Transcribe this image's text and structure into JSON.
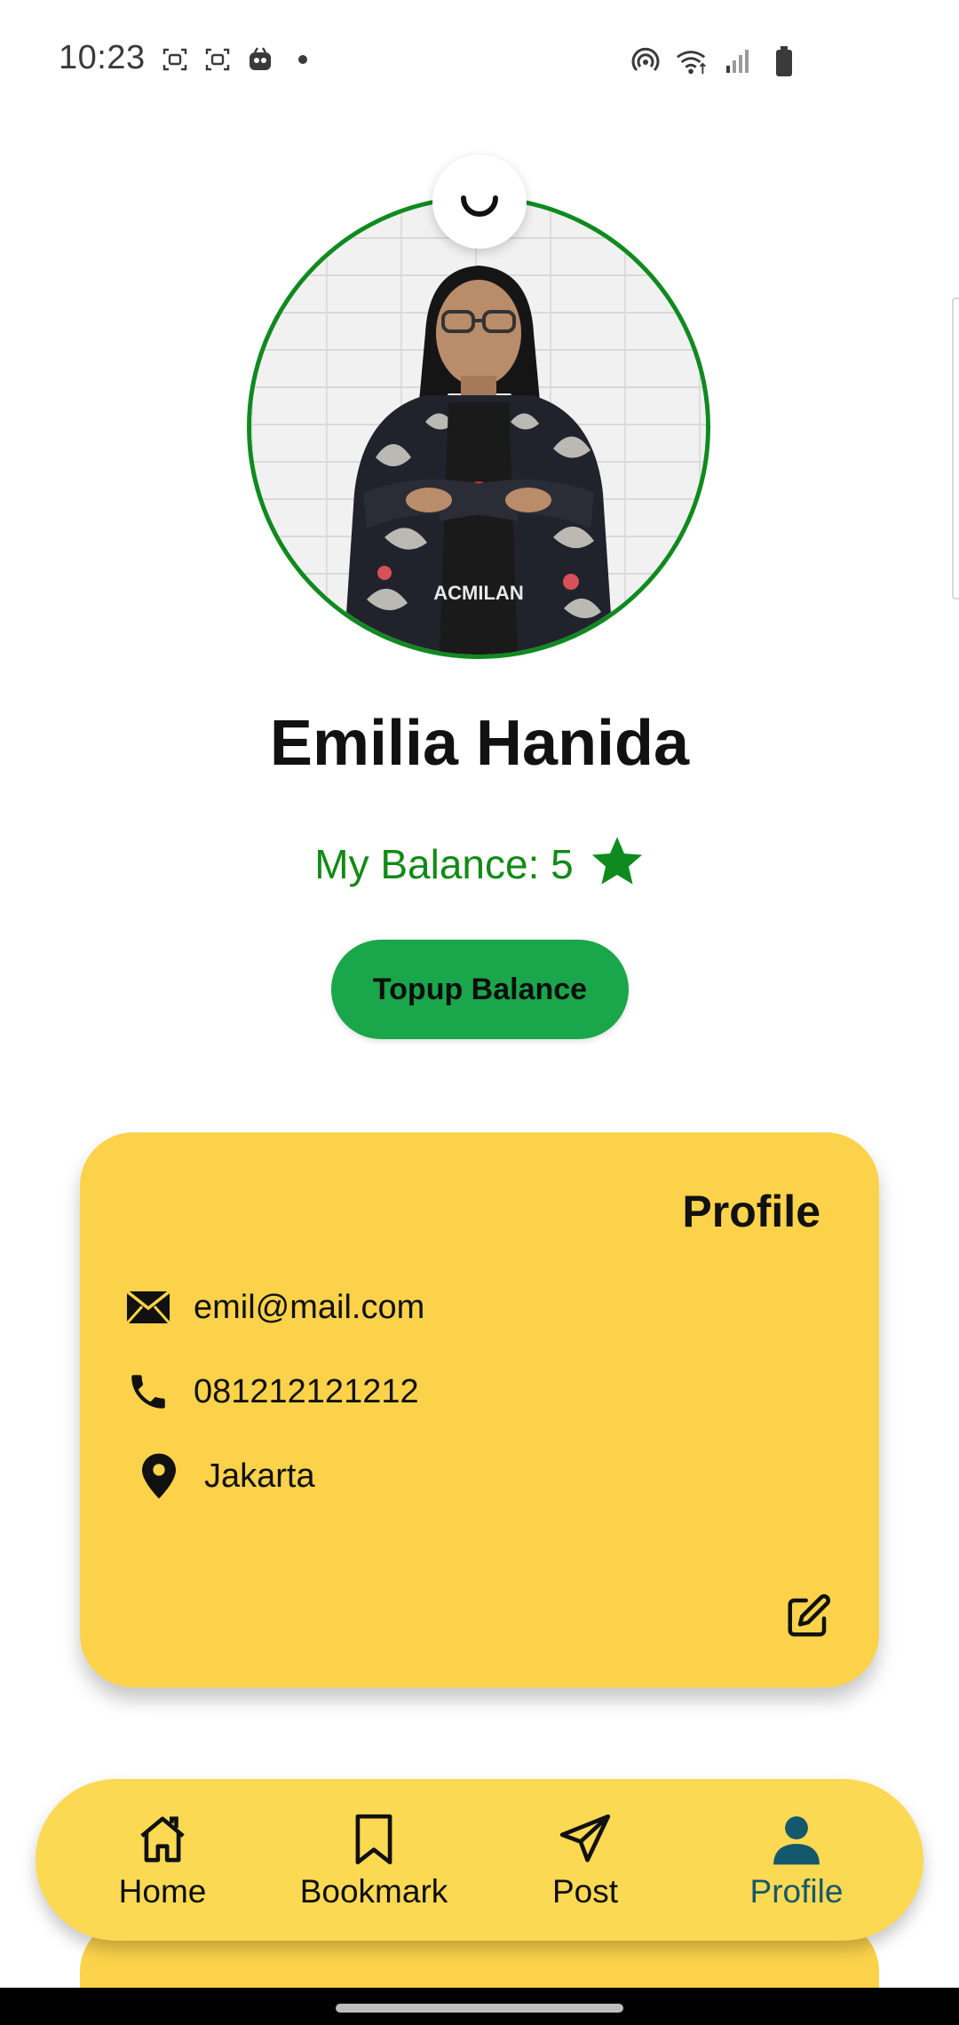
{
  "status_bar": {
    "time": "10:23",
    "left_icons": [
      "screen-record-icon",
      "screen-record-icon",
      "app-notification-icon"
    ],
    "right_icons": [
      "hotspot-icon",
      "wifi-icon",
      "cellular-signal-icon",
      "battery-icon"
    ]
  },
  "profile": {
    "name": "Emilia Hanida",
    "balance_label": "My Balance: 5",
    "balance_icon": "star-icon",
    "topup_label": "Topup Balance"
  },
  "card": {
    "title": "Profile",
    "email": "emil@mail.com",
    "phone": "081212121212",
    "location": "Jakarta",
    "edit_icon": "edit-icon"
  },
  "nav": {
    "items": [
      {
        "label": "Home",
        "icon": "home-icon",
        "active": false
      },
      {
        "label": "Bookmark",
        "icon": "bookmark-icon",
        "active": false
      },
      {
        "label": "Post",
        "icon": "send-icon",
        "active": false
      },
      {
        "label": "Profile",
        "icon": "person-icon",
        "active": true
      }
    ]
  },
  "colors": {
    "accent_green": "#1aa64b",
    "balance_green": "#138a17",
    "avatar_border": "#0f8a1f",
    "card_yellow": "#fbd24a",
    "nav_yellow": "#fcd953",
    "active_nav": "#14586b"
  }
}
